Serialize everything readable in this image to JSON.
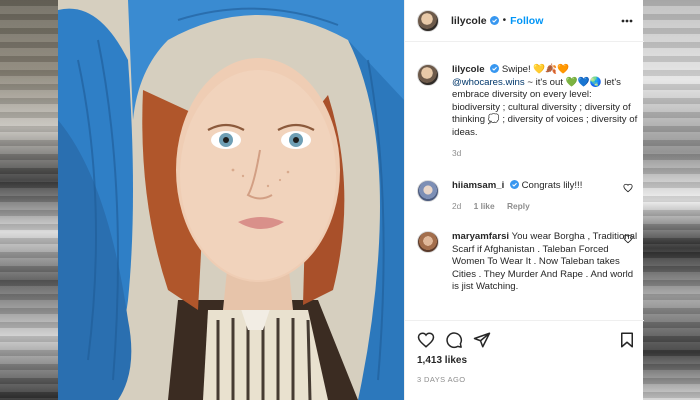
{
  "post": {
    "username": "lilycole",
    "follow_label": "Follow",
    "separator": "•"
  },
  "caption": {
    "username": "lilycole",
    "line1": "Swipe! 💛🍂🧡",
    "mention": "@whocares.wins",
    "text": "~ it's out 💚💙🌏 let's embrace diversity on every level: biodiversity ; cultural diversity ; diversity of thinking 💭 ; diversity of voices ; diversity of ideas.",
    "time": "3d"
  },
  "comments": [
    {
      "username": "hiiamsam_i",
      "text": "Congrats lily!!!",
      "time": "2d",
      "likes": "1 like",
      "reply": "Reply"
    },
    {
      "username": "maryamfarsi",
      "text": "You wear Borgha , Traditional Scarf if Afghanistan . Taleban Forced Women To Wear It . Now Taleban takes Cities . They Murder And Rape . And world is jist Watching."
    }
  ],
  "footer": {
    "likes": "1,413 likes",
    "timeago": "3 DAYS AGO"
  },
  "colors": {
    "link_blue": "#0095f6",
    "verified_blue": "#3897f0",
    "muted": "#8e8e8e",
    "scarf_blue": "#2f7fc6"
  },
  "icons": {
    "more": "more-horizontal-icon",
    "verified": "verified-badge-icon",
    "heart": "heart-icon",
    "comment": "comment-icon",
    "share": "share-icon",
    "save": "bookmark-icon",
    "next": "chevron-right-icon"
  }
}
